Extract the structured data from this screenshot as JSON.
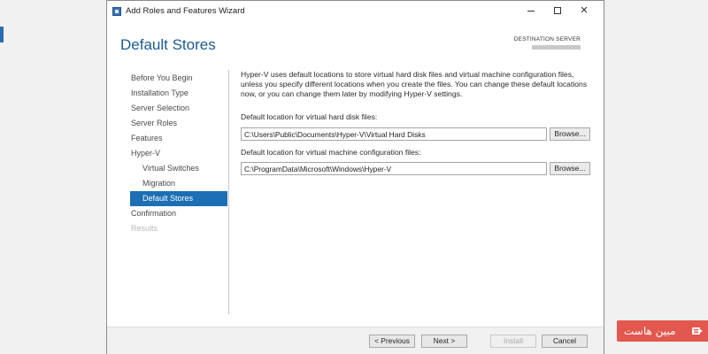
{
  "window": {
    "title": "Add Roles and Features Wizard",
    "controls": {
      "minimize": "minimize",
      "maximize": "maximize",
      "close": "✕"
    }
  },
  "header": {
    "page_title": "Default Stores",
    "destination_label": "DESTINATION SERVER"
  },
  "sidebar": {
    "items": [
      {
        "label": "Before You Begin",
        "level": 0,
        "state": "normal"
      },
      {
        "label": "Installation Type",
        "level": 0,
        "state": "normal"
      },
      {
        "label": "Server Selection",
        "level": 0,
        "state": "normal"
      },
      {
        "label": "Server Roles",
        "level": 0,
        "state": "normal"
      },
      {
        "label": "Features",
        "level": 0,
        "state": "normal"
      },
      {
        "label": "Hyper-V",
        "level": 0,
        "state": "normal"
      },
      {
        "label": "Virtual Switches",
        "level": 1,
        "state": "normal"
      },
      {
        "label": "Migration",
        "level": 1,
        "state": "normal"
      },
      {
        "label": "Default Stores",
        "level": 1,
        "state": "selected"
      },
      {
        "label": "Confirmation",
        "level": 0,
        "state": "normal"
      },
      {
        "label": "Results",
        "level": 0,
        "state": "disabled"
      }
    ]
  },
  "main": {
    "intro": "Hyper-V uses default locations to store virtual hard disk files and virtual machine configuration files, unless you specify different locations when you create the files. You can change these default locations now, or you can change them later by modifying Hyper-V settings.",
    "vhd": {
      "label": "Default location for virtual hard disk files:",
      "value": "C:\\Users\\Public\\Documents\\Hyper-V\\Virtual Hard Disks",
      "browse_label": "Browse..."
    },
    "vm": {
      "label": "Default location for virtual machine configuration files:",
      "value": "C:\\ProgramData\\Microsoft\\Windows\\Hyper-V",
      "browse_label": "Browse..."
    }
  },
  "footer": {
    "previous_label": "< Previous",
    "next_label": "Next >",
    "install_label": "Install",
    "cancel_label": "Cancel"
  },
  "watermark": {
    "text": "مبین هاست",
    "color": "#e3584e"
  },
  "colors": {
    "title_blue": "#1b5a93",
    "selection_blue": "#1c6fb4"
  }
}
